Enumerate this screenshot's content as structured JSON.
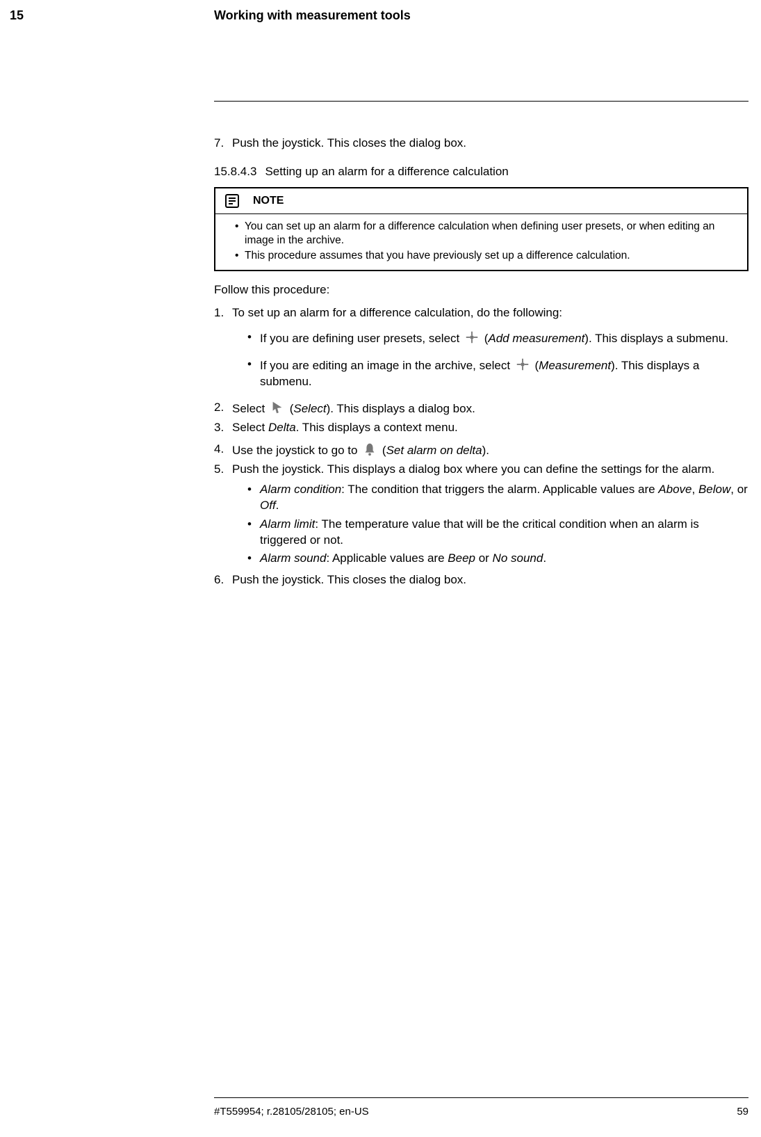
{
  "header": {
    "chapter_num": "15",
    "chapter_title": "Working with measurement tools"
  },
  "step7": {
    "num": "7.",
    "text": "Push the joystick. This closes the dialog box."
  },
  "section": {
    "num": "15.8.4.3",
    "title": "Setting up an alarm for a difference calculation"
  },
  "note": {
    "label": "NOTE",
    "items": [
      "You can set up an alarm for a difference calculation when defining user presets, or when editing an image in the archive.",
      "This procedure assumes that you have previously set up a difference calculation."
    ]
  },
  "follow": "Follow this procedure:",
  "s1": {
    "num": "1.",
    "lead": "To set up an alarm for a difference calculation, do the following:",
    "b1_pre": "If you are defining user presets, select ",
    "b1_icon_label": "Add measurement",
    "b1_post": "). This displays a submenu.",
    "b2_pre": "If you are editing an image in the archive, select ",
    "b2_icon_label": "Measurement",
    "b2_post": "). This displays a submenu."
  },
  "s2": {
    "num": "2.",
    "pre": "Select ",
    "icon_label": "Select",
    "post": "). This displays a dialog box."
  },
  "s3": {
    "num": "3.",
    "pre": "Select ",
    "term": "Delta",
    "post": ". This displays a context menu."
  },
  "s4": {
    "num": "4.",
    "pre": "Use the joystick to go to ",
    "icon_label": "Set alarm on delta",
    "post": ")."
  },
  "s5": {
    "num": "5.",
    "text": "Push the joystick. This displays a dialog box where you can define the settings for the alarm."
  },
  "s5b": {
    "a_term": "Alarm condition",
    "a_text": ": The condition that triggers the alarm. Applicable values are ",
    "a_v1": "Above",
    "a_v2": "Below",
    "a_v3": "Off",
    "b_term": "Alarm limit",
    "b_text": ": The temperature value that will be the critical condition when an alarm is triggered or not.",
    "c_term": "Alarm sound",
    "c_text": ": Applicable values are ",
    "c_v1": "Beep",
    "c_v2": "No sound"
  },
  "s6": {
    "num": "6.",
    "text": "Push the joystick. This closes the dialog box."
  },
  "footer": {
    "left": "#T559954; r.28105/28105; en-US",
    "right": "59"
  }
}
